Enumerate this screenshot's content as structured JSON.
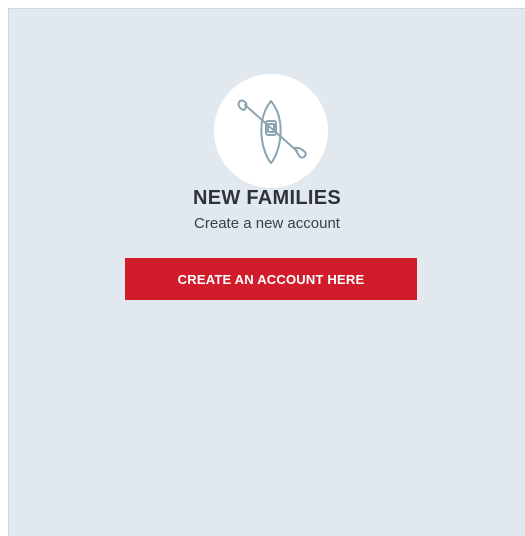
{
  "card": {
    "icon": "kayak-icon",
    "title": "NEW FAMILIES",
    "subtitle": "Create a new account",
    "cta_label": "CREATE AN ACCOUNT HERE"
  },
  "colors": {
    "card_background": "#e1e9ef",
    "button_background": "#d01c2b",
    "icon_stroke": "#8aa4b1",
    "title_text": "#2d3338"
  }
}
